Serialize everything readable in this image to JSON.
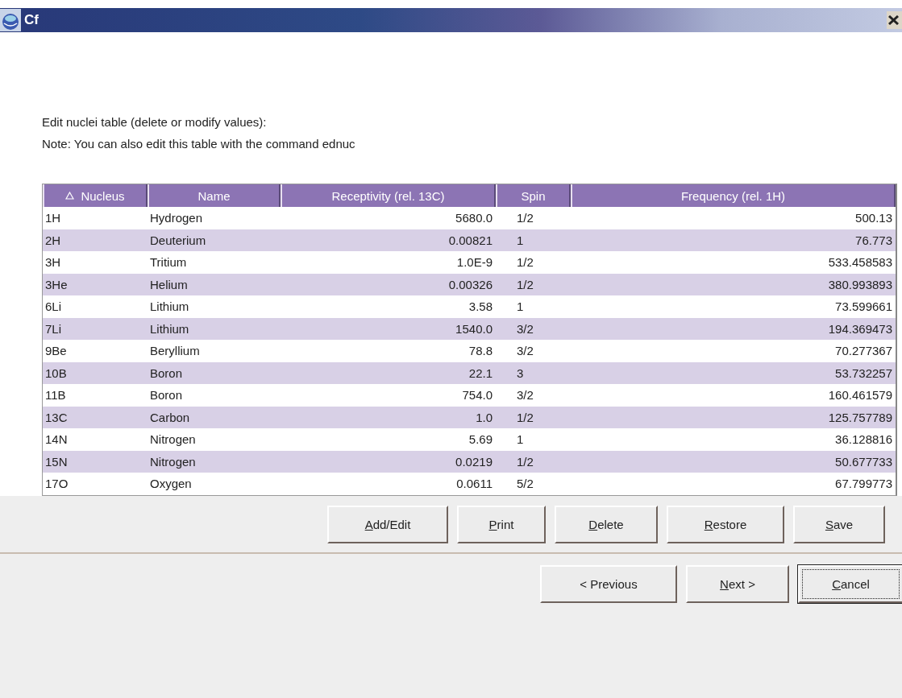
{
  "window": {
    "title": "Cf"
  },
  "instructions": [
    "Edit nuclei table (delete or modify values):",
    "Note: You can also edit this table with the command ednuc"
  ],
  "table": {
    "columns": [
      {
        "label": "Nucleus",
        "sorted": true,
        "kind": "text"
      },
      {
        "label": "Name",
        "sorted": false,
        "kind": "text"
      },
      {
        "label": "Receptivity (rel. 13C)",
        "sorted": false,
        "kind": "number"
      },
      {
        "label": "Spin",
        "sorted": false,
        "kind": "spin"
      },
      {
        "label": "Frequency (rel. 1H)",
        "sorted": false,
        "kind": "number"
      }
    ],
    "rows": [
      [
        "1H",
        "Hydrogen",
        "5680.0",
        "1/2",
        "500.13"
      ],
      [
        "2H",
        "Deuterium",
        "0.00821",
        "1",
        "76.773"
      ],
      [
        "3H",
        "Tritium",
        "1.0E-9",
        "1/2",
        "533.458583"
      ],
      [
        "3He",
        "Helium",
        "0.00326",
        "1/2",
        "380.993893"
      ],
      [
        "6Li",
        "Lithium",
        "3.58",
        "1",
        "73.599661"
      ],
      [
        "7Li",
        "Lithium",
        "1540.0",
        "3/2",
        "194.369473"
      ],
      [
        "9Be",
        "Beryllium",
        "78.8",
        "3/2",
        "70.277367"
      ],
      [
        "10B",
        "Boron",
        "22.1",
        "3",
        "53.732257"
      ],
      [
        "11B",
        "Boron",
        "754.0",
        "3/2",
        "160.461579"
      ],
      [
        "13C",
        "Carbon",
        "1.0",
        "1/2",
        "125.757789"
      ],
      [
        "14N",
        "Nitrogen",
        "5.69",
        "1",
        "36.128816"
      ],
      [
        "15N",
        "Nitrogen",
        "0.0219",
        "1/2",
        "50.677733"
      ],
      [
        "17O",
        "Oxygen",
        "0.0611",
        "5/2",
        "67.799773"
      ]
    ]
  },
  "table_buttons": [
    {
      "label": "Add/Edit",
      "mnemonic": true,
      "focused": false
    },
    {
      "label": "Print",
      "mnemonic": true,
      "focused": false
    },
    {
      "label": "Delete",
      "mnemonic": true,
      "focused": false
    },
    {
      "label": "Restore",
      "mnemonic": true,
      "focused": false
    },
    {
      "label": "Save",
      "mnemonic": true,
      "focused": false
    }
  ],
  "nav_buttons": [
    {
      "label": "< Previous",
      "mnemonic": false,
      "focused": false
    },
    {
      "label": "Next >",
      "mnemonic": true,
      "focused": false
    },
    {
      "label": "Cancel",
      "mnemonic": true,
      "focused": true
    }
  ]
}
